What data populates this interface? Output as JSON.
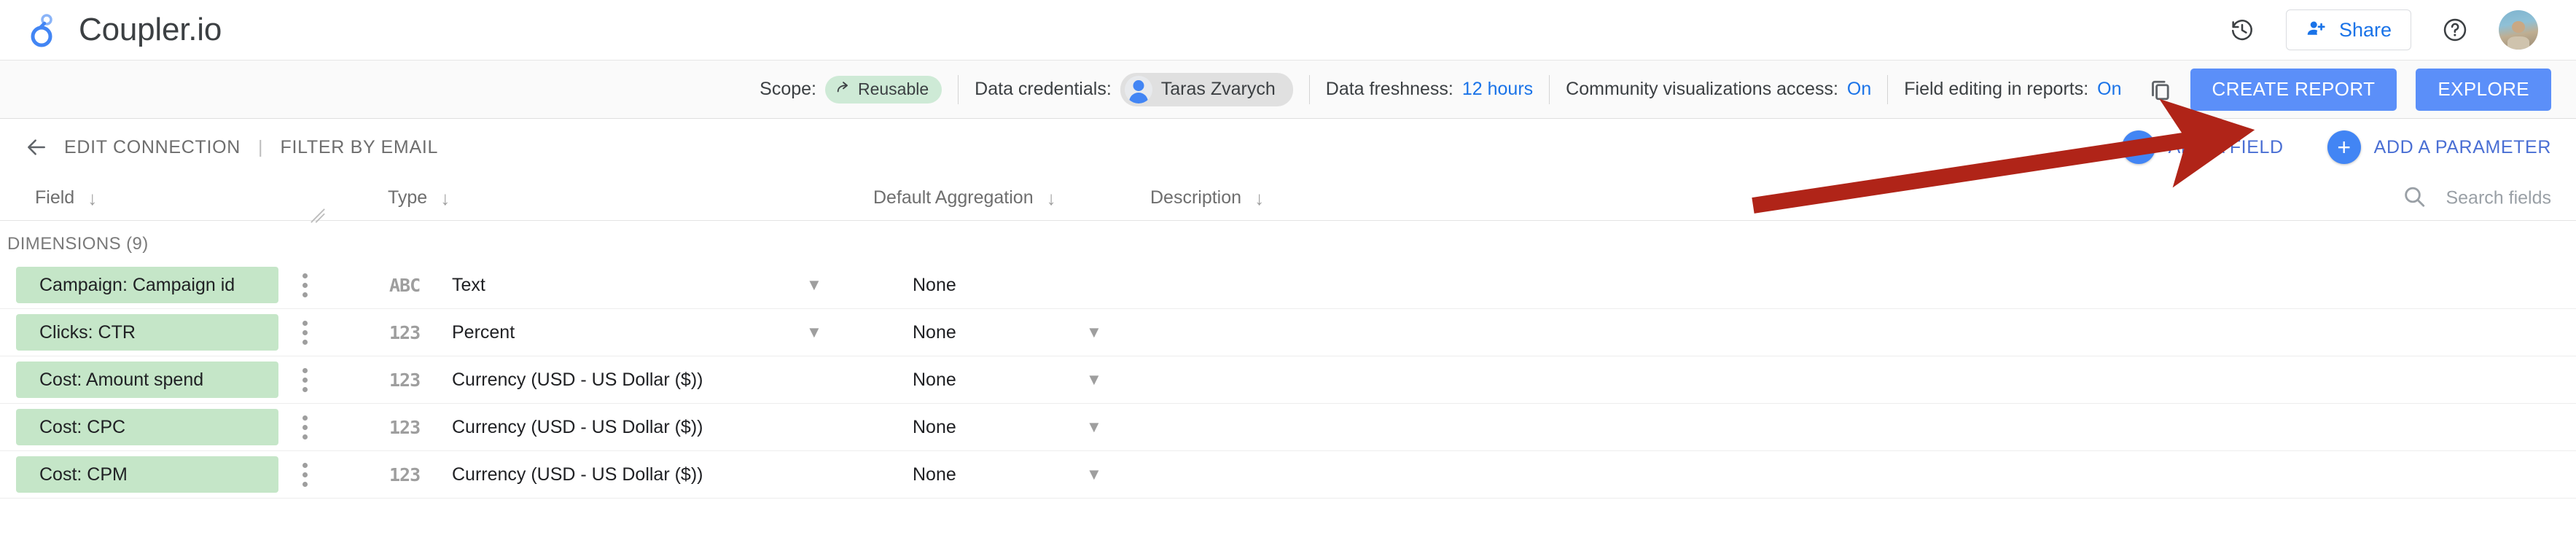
{
  "app": {
    "brand_name": "Coupler.io"
  },
  "topbar": {
    "version_history_icon": "history-icon",
    "share_label": "Share",
    "share_icon": "person-add-icon",
    "help_icon": "help-circle-icon",
    "avatar": "user-avatar"
  },
  "metabar": {
    "scope_label": "Scope:",
    "scope_value": "Reusable",
    "scope_icon": "share-arrow-icon",
    "credentials_label": "Data credentials:",
    "credentials_value": "Taras Zvarych",
    "freshness_label": "Data freshness:",
    "freshness_value": "12 hours",
    "community_label": "Community visualizations access:",
    "community_value": "On",
    "field_editing_label": "Field editing in reports:",
    "field_editing_value": "On",
    "copy_icon": "copy-icon",
    "create_report_label": "CREATE REPORT",
    "explore_label": "EXPLORE",
    "accent_blue": "#5b8ff9",
    "link_blue": "#1a73e8",
    "pill_green_bg": "#ceead6",
    "pill_grey_bg": "#e0e0e0"
  },
  "actionrow": {
    "back_icon": "back-arrow-icon",
    "edit_connection_label": "EDIT CONNECTION",
    "divider": "|",
    "filter_by_email_label": "FILTER BY EMAIL",
    "add_field_label": "ADD A FIELD",
    "add_parameter_label": "ADD A PARAMETER",
    "plus_glyph": "+"
  },
  "table": {
    "headers": {
      "field": "Field",
      "type": "Type",
      "aggregation": "Default Aggregation",
      "description": "Description",
      "sort_glyph": "↓"
    },
    "search_placeholder": "Search fields",
    "search_icon": "search-icon",
    "section_label": "DIMENSIONS (9)",
    "rows": [
      {
        "field": "Campaign: Campaign id",
        "type_icon": "ABC",
        "type": "Text",
        "has_type_caret": true,
        "aggregation": "None",
        "has_agg_caret": false,
        "description": ""
      },
      {
        "field": "Clicks: CTR",
        "type_icon": "123",
        "type": "Percent",
        "has_type_caret": true,
        "aggregation": "None",
        "has_agg_caret": true,
        "description": ""
      },
      {
        "field": "Cost: Amount spend",
        "type_icon": "123",
        "type": "Currency (USD - US Dollar ($))",
        "has_type_caret": false,
        "aggregation": "None",
        "has_agg_caret": true,
        "description": ""
      },
      {
        "field": "Cost: CPC",
        "type_icon": "123",
        "type": "Currency (USD - US Dollar ($))",
        "has_type_caret": false,
        "aggregation": "None",
        "has_agg_caret": true,
        "description": ""
      },
      {
        "field": "Cost: CPM",
        "type_icon": "123",
        "type": "Currency (USD - US Dollar ($))",
        "has_type_caret": false,
        "aggregation": "None",
        "has_agg_caret": true,
        "description": ""
      }
    ]
  },
  "annotation": {
    "type": "arrow",
    "color": "#b02418",
    "points_to": "copy-icon"
  }
}
